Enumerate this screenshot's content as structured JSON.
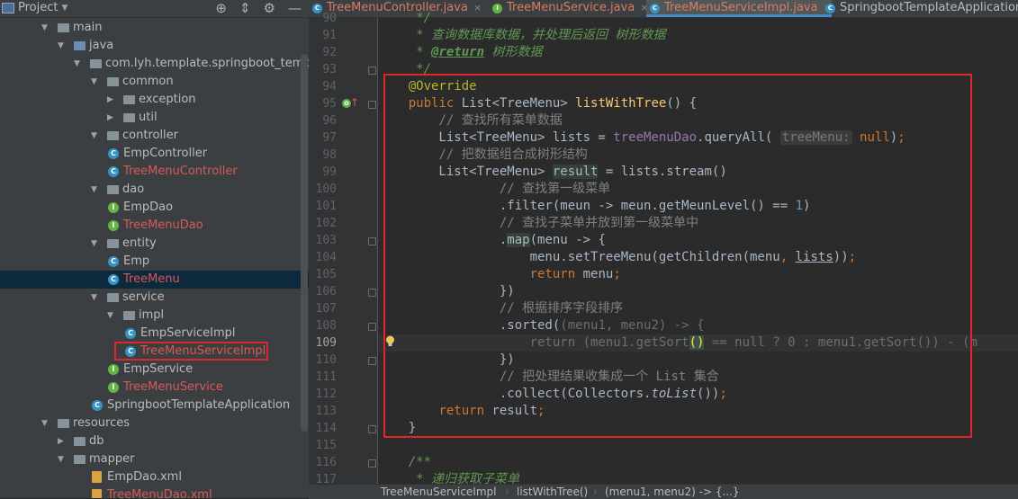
{
  "project_panel": {
    "title": "Project",
    "tree": [
      {
        "label": "main",
        "kind": "folder",
        "level": 3,
        "arrow": "down"
      },
      {
        "label": "java",
        "kind": "folder-blue",
        "level": 4,
        "arrow": "down"
      },
      {
        "label": "com.lyh.template.springboot_template",
        "kind": "folder",
        "level": 5,
        "arrow": "down"
      },
      {
        "label": "common",
        "kind": "folder",
        "level": 6,
        "arrow": "down"
      },
      {
        "label": "exception",
        "kind": "folder",
        "level": 7,
        "arrow": "right"
      },
      {
        "label": "util",
        "kind": "folder",
        "level": 7,
        "arrow": "right"
      },
      {
        "label": "controller",
        "kind": "folder",
        "level": 6,
        "arrow": "down"
      },
      {
        "label": "EmpController",
        "kind": "class",
        "level": 7,
        "arrow": ""
      },
      {
        "label": "TreeMenuController",
        "kind": "class",
        "level": 7,
        "arrow": "",
        "red": true
      },
      {
        "label": "dao",
        "kind": "folder",
        "level": 6,
        "arrow": "down"
      },
      {
        "label": "EmpDao",
        "kind": "interface",
        "level": 7,
        "arrow": ""
      },
      {
        "label": "TreeMenuDao",
        "kind": "interface",
        "level": 7,
        "arrow": "",
        "red": true
      },
      {
        "label": "entity",
        "kind": "folder",
        "level": 6,
        "arrow": "down"
      },
      {
        "label": "Emp",
        "kind": "class",
        "level": 7,
        "arrow": ""
      },
      {
        "label": "TreeMenu",
        "kind": "class",
        "level": 7,
        "arrow": "",
        "red": true,
        "selected": true
      },
      {
        "label": "service",
        "kind": "folder",
        "level": 6,
        "arrow": "down"
      },
      {
        "label": "impl",
        "kind": "folder",
        "level": 7,
        "arrow": "down"
      },
      {
        "label": "EmpServiceImpl",
        "kind": "class",
        "level": 8,
        "arrow": ""
      },
      {
        "label": "TreeMenuServiceImpl",
        "kind": "class",
        "level": 8,
        "arrow": "",
        "red": true
      },
      {
        "label": "EmpService",
        "kind": "interface",
        "level": 7,
        "arrow": ""
      },
      {
        "label": "TreeMenuService",
        "kind": "interface",
        "level": 7,
        "arrow": "",
        "red": true
      },
      {
        "label": "SpringbootTemplateApplication",
        "kind": "class",
        "level": 6,
        "arrow": ""
      },
      {
        "label": "resources",
        "kind": "folder",
        "level": 3,
        "arrow": "down"
      },
      {
        "label": "db",
        "kind": "folder",
        "level": 4,
        "arrow": "right"
      },
      {
        "label": "mapper",
        "kind": "folder",
        "level": 4,
        "arrow": "down"
      },
      {
        "label": "EmpDao.xml",
        "kind": "xml",
        "level": 6,
        "arrow": ""
      },
      {
        "label": "TreeMenuDao.xml",
        "kind": "xml",
        "level": 6,
        "arrow": "",
        "red": true
      }
    ]
  },
  "tabs": [
    {
      "label": "TreeMenuController.java",
      "icon": "class-icon",
      "color": "#3592c4",
      "closable": true
    },
    {
      "label": "TreeMenuService.java",
      "icon": "interface-icon",
      "color": "#62b543",
      "closable": true
    },
    {
      "label": "TreeMenuServiceImpl.java",
      "icon": "class-icon",
      "color": "#3592c4",
      "closable": true,
      "active": true
    },
    {
      "label": "SpringbootTemplateApplication.",
      "icon": "class-icon",
      "color": "#3592c4",
      "closable": false
    }
  ],
  "editor": {
    "current_line": 109,
    "lines": [
      {
        "n": "90",
        "html": "     <span class=\"doc\">*/</span>"
      },
      {
        "n": "91",
        "html": "     <span class=\"doc\">* 查询数据库数据，并处理后返回 树形数据</span>"
      },
      {
        "n": "92",
        "html": "     <span class=\"doc\">* </span><span class=\"doctag\">@return</span><span class=\"doc\"> 树形数据</span>"
      },
      {
        "n": "93",
        "html": "     <span class=\"doc\">*/</span>"
      },
      {
        "n": "94",
        "html": "    <span class=\"ann\">@Override</span>"
      },
      {
        "n": "95",
        "html": "    <span class=\"kw\">public</span> List&lt;TreeMenu&gt; <span class=\"fn\">listWithTree</span>() {"
      },
      {
        "n": "96",
        "html": "        <span class=\"cm\">// 查找所有菜单数据</span>"
      },
      {
        "n": "97",
        "html": "        List&lt;TreeMenu&gt; lists = <span class=\"fld\">treeMenuDao</span>.queryAll( <span class=\"hint\">treeMenu:</span> <span class=\"kw\">null</span>)<span class=\"kw\">;</span>"
      },
      {
        "n": "98",
        "html": "        <span class=\"cm\">// 把数据组合成树形结构</span>"
      },
      {
        "n": "99",
        "html": "        List&lt;TreeMenu&gt; <span class=\"hl\">result</span> = lists.stream()"
      },
      {
        "n": "100",
        "html": "                <span class=\"cm\">// 查找第一级菜单</span>"
      },
      {
        "n": "101",
        "html": "                .filter(meun -&gt; meun.getMeunLevel() == <span class=\"num\">1</span>)"
      },
      {
        "n": "102",
        "html": "                <span class=\"cm\">// 查找子菜单并放到第一级菜单中</span>"
      },
      {
        "n": "103",
        "html": "                .<span class=\"hl\">map</span>(menu -&gt; {"
      },
      {
        "n": "104",
        "html": "                    menu.setTreeMenu(getChildren(menu<span class=\"kw\">,</span> <span class=\"ul\">lists</span>))<span class=\"kw\">;</span>"
      },
      {
        "n": "105",
        "html": "                    <span class=\"kw\">return</span> menu<span class=\"kw\">;</span>"
      },
      {
        "n": "106",
        "html": "                })"
      },
      {
        "n": "107",
        "html": "                <span class=\"cm\">// 根据排序字段排序</span>"
      },
      {
        "n": "108",
        "html": "                .sorted(<span class=\"dim\">(menu1, menu2) -&gt; {</span>"
      },
      {
        "n": "109",
        "html": "                    <span class=\"dim\">return (menu1.getSort</span><span class=\"bracket\">()</span><span class=\"dim\"> == null ? 0 : menu1.getSort()) - (m</span>"
      },
      {
        "n": "110",
        "html": "                })"
      },
      {
        "n": "111",
        "html": "                <span class=\"cm\">// 把处理结果收集成一个 List 集合</span>"
      },
      {
        "n": "112",
        "html": "                .collect(Collectors.<span class=\"it\">toList</span>())<span class=\"kw\">;</span>"
      },
      {
        "n": "113",
        "html": "        <span class=\"kw\">return</span> result<span class=\"kw\">;</span>"
      },
      {
        "n": "114",
        "html": "    }"
      },
      {
        "n": "115",
        "html": ""
      },
      {
        "n": "116",
        "html": "    <span class=\"doc\">/**</span>"
      },
      {
        "n": "117",
        "html": "     <span class=\"doc\">* 递归获取子菜单</span>"
      }
    ]
  },
  "breadcrumb": {
    "items": [
      "TreeMenuServiceImpl",
      "listWithTree()",
      "(menu1, menu2) -> {...}"
    ]
  }
}
